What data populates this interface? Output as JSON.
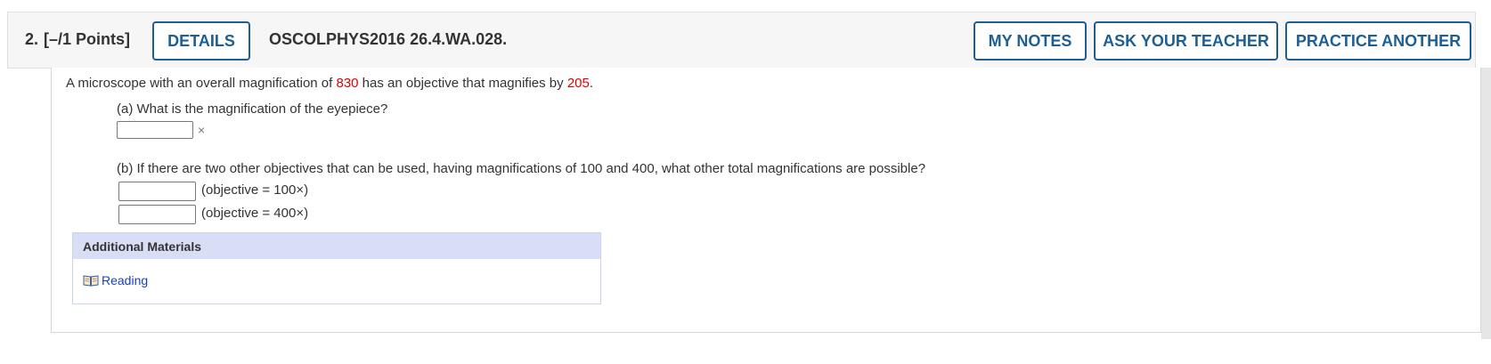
{
  "header": {
    "question_number": "2.",
    "points": "[–/1 Points]",
    "details_label": "DETAILS",
    "question_code": "OSCOLPHYS2016 26.4.WA.028.",
    "my_notes_label": "MY NOTES",
    "ask_teacher_label": "ASK YOUR TEACHER",
    "practice_another_label": "PRACTICE ANOTHER"
  },
  "problem": {
    "intro_before": "A microscope with an overall magnification of ",
    "overall_magnification": "830",
    "intro_middle": " has an objective that magnifies by ",
    "objective_magnification": "205",
    "intro_after": ".",
    "part_a": "(a) What is the magnification of the eyepiece?",
    "part_a_unit": "×",
    "part_a_value": "",
    "part_b": "(b) If there are two other objectives that can be used, having magnifications of 100 and 400, what other total magnifications are possible?",
    "part_b_answers": [
      {
        "value": "",
        "label": "(objective = 100×)"
      },
      {
        "value": "",
        "label": "(objective = 400×)"
      }
    ]
  },
  "materials": {
    "title": "Additional Materials",
    "links": [
      {
        "label": "Reading",
        "icon": "book-icon"
      }
    ]
  },
  "colors": {
    "accent": "#1d5e94",
    "highlight_red": "#e00000",
    "materials_header_bg": "#d8def6",
    "link": "#1a3ec7"
  }
}
